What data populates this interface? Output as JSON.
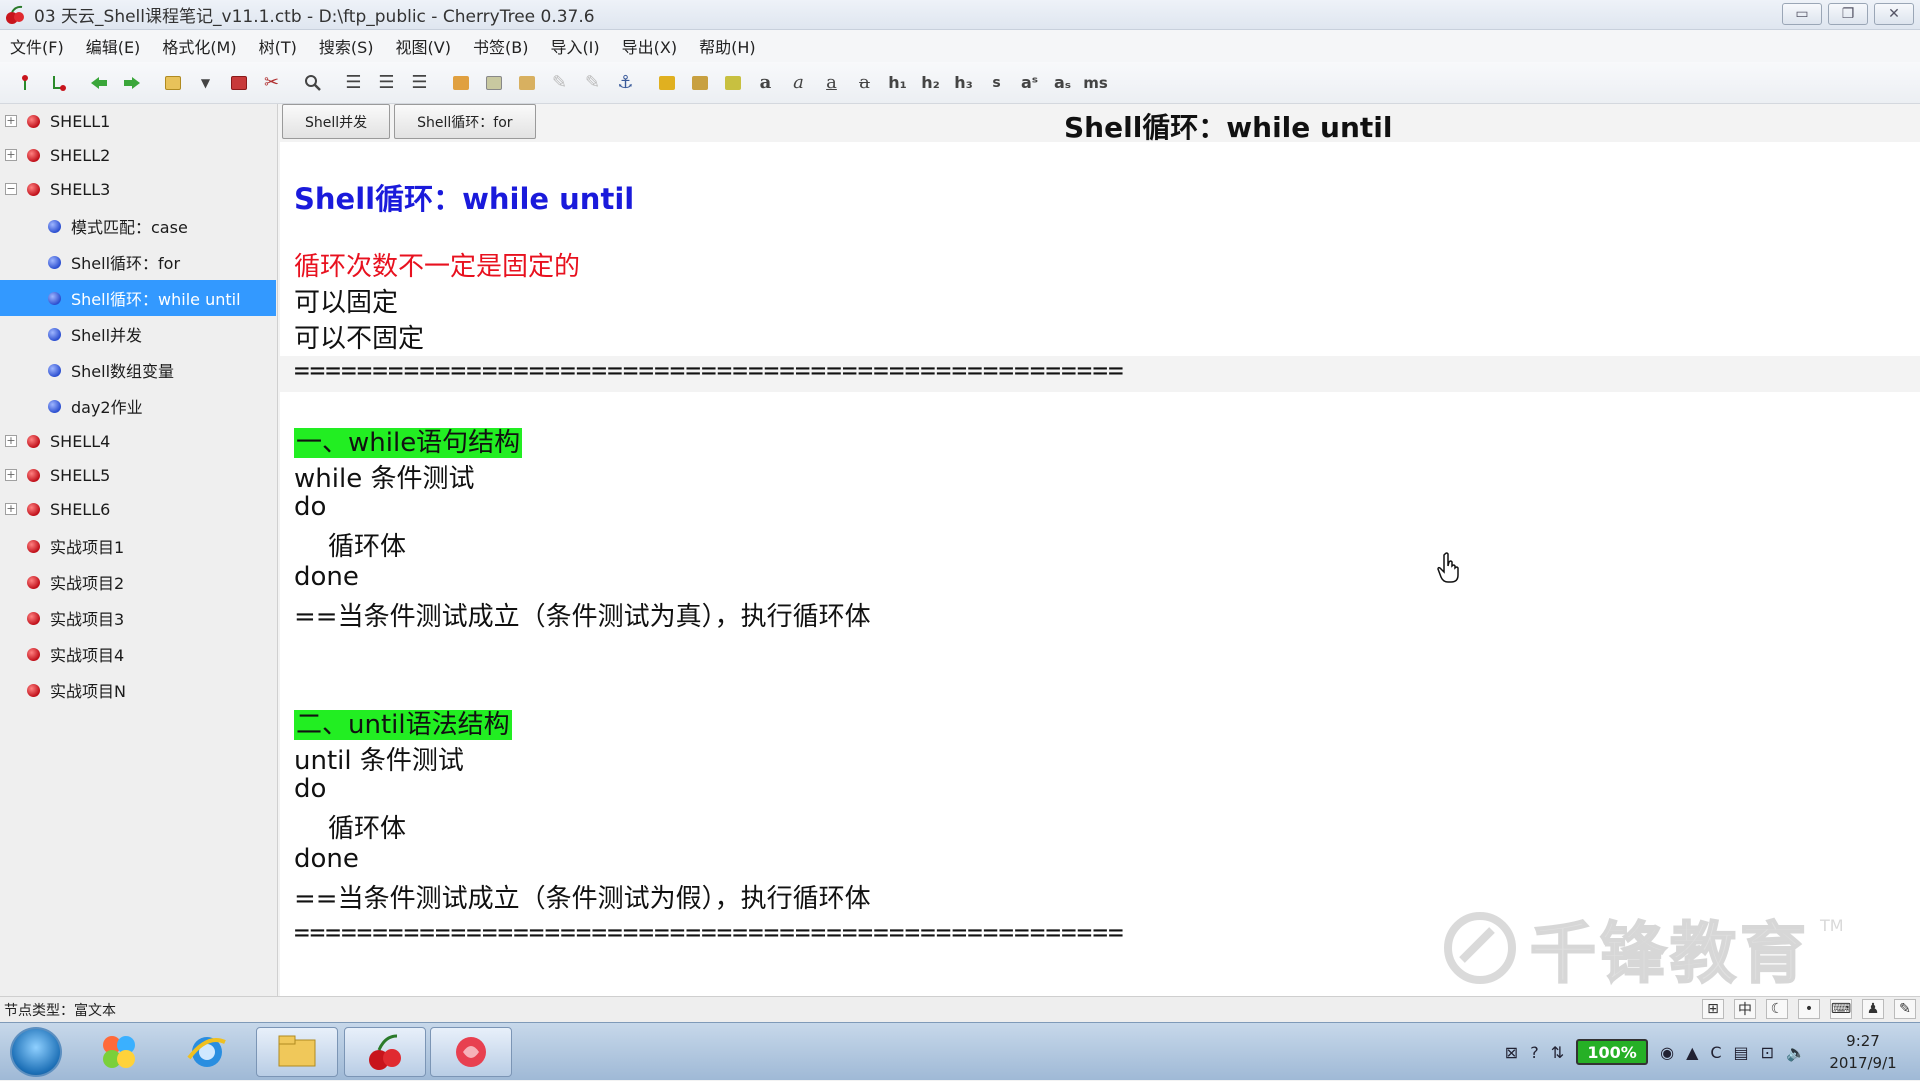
{
  "window": {
    "title": "03 天云_Shell课程笔记_v11.1.ctb - D:\\ftp_public - CherryTree 0.37.6",
    "controls": {
      "minimize": "▭",
      "restore": "❐",
      "close": "✕"
    }
  },
  "menu": [
    "文件(F)",
    "编辑(E)",
    "格式化(M)",
    "树(T)",
    "搜索(S)",
    "视图(V)",
    "书签(B)",
    "导入(I)",
    "导出(X)",
    "帮助(H)"
  ],
  "toolbar": {
    "format_labels": [
      "a",
      "a",
      "a",
      "a",
      "h₁",
      "h₂",
      "h₃",
      "s",
      "aˢ",
      "aₛ",
      "ms"
    ]
  },
  "tree": {
    "nodes": [
      {
        "label": "SHELL1",
        "level": 0,
        "expander": "+"
      },
      {
        "label": "SHELL2",
        "level": 0,
        "expander": "+"
      },
      {
        "label": "SHELL3",
        "level": 0,
        "expander": "−"
      },
      {
        "label": "模式匹配：case",
        "level": 1
      },
      {
        "label": "Shell循环：for",
        "level": 1
      },
      {
        "label": "Shell循环：while until",
        "level": 1,
        "selected": true
      },
      {
        "label": "Shell并发",
        "level": 1
      },
      {
        "label": "Shell数组变量",
        "level": 1
      },
      {
        "label": "day2作业",
        "level": 1
      },
      {
        "label": "SHELL4",
        "level": 0,
        "expander": "+"
      },
      {
        "label": "SHELL5",
        "level": 0,
        "expander": "+"
      },
      {
        "label": "SHELL6",
        "level": 0,
        "expander": "+"
      },
      {
        "label": "实战项目1",
        "level": 0
      },
      {
        "label": "实战项目2",
        "level": 0
      },
      {
        "label": "实战项目3",
        "level": 0
      },
      {
        "label": "实战项目4",
        "level": 0
      },
      {
        "label": "实战项目N",
        "level": 0
      }
    ]
  },
  "tabs": [
    "Shell并发",
    "Shell循环：for"
  ],
  "node_title": "Shell循环：while until",
  "content": {
    "heading": "Shell循环：while until",
    "intro_red": "循环次数不一定是固定的",
    "intro1": "可以固定",
    "intro2": "可以不固定",
    "separator": "=====================================================",
    "section1_title": "一、while语句结构",
    "s1_l1": "while 条件测试",
    "s1_l2": "do",
    "s1_l3": "循环体",
    "s1_l4": "done",
    "s1_l5": "==当条件测试成立（条件测试为真），执行循环体",
    "section2_title": "二、until语法结构",
    "s2_l1": "until 条件测试",
    "s2_l2": "do",
    "s2_l3": "循环体",
    "s2_l4": "done",
    "s2_l5": "==当条件测试成立（条件测试为假），执行循环体",
    "separator2": "====================================================="
  },
  "watermark": {
    "text": "千锋教育",
    "tm": "TM"
  },
  "statusbar": {
    "node_type": "节点类型：富文本"
  },
  "taskbar": {
    "battery": "100%",
    "time": "9:27",
    "date": "2017/9/1"
  },
  "colors": {
    "heading": "#1a1adb",
    "red_text": "#e8111f",
    "highlight": "#22ee22",
    "selection": "#3399ff"
  }
}
